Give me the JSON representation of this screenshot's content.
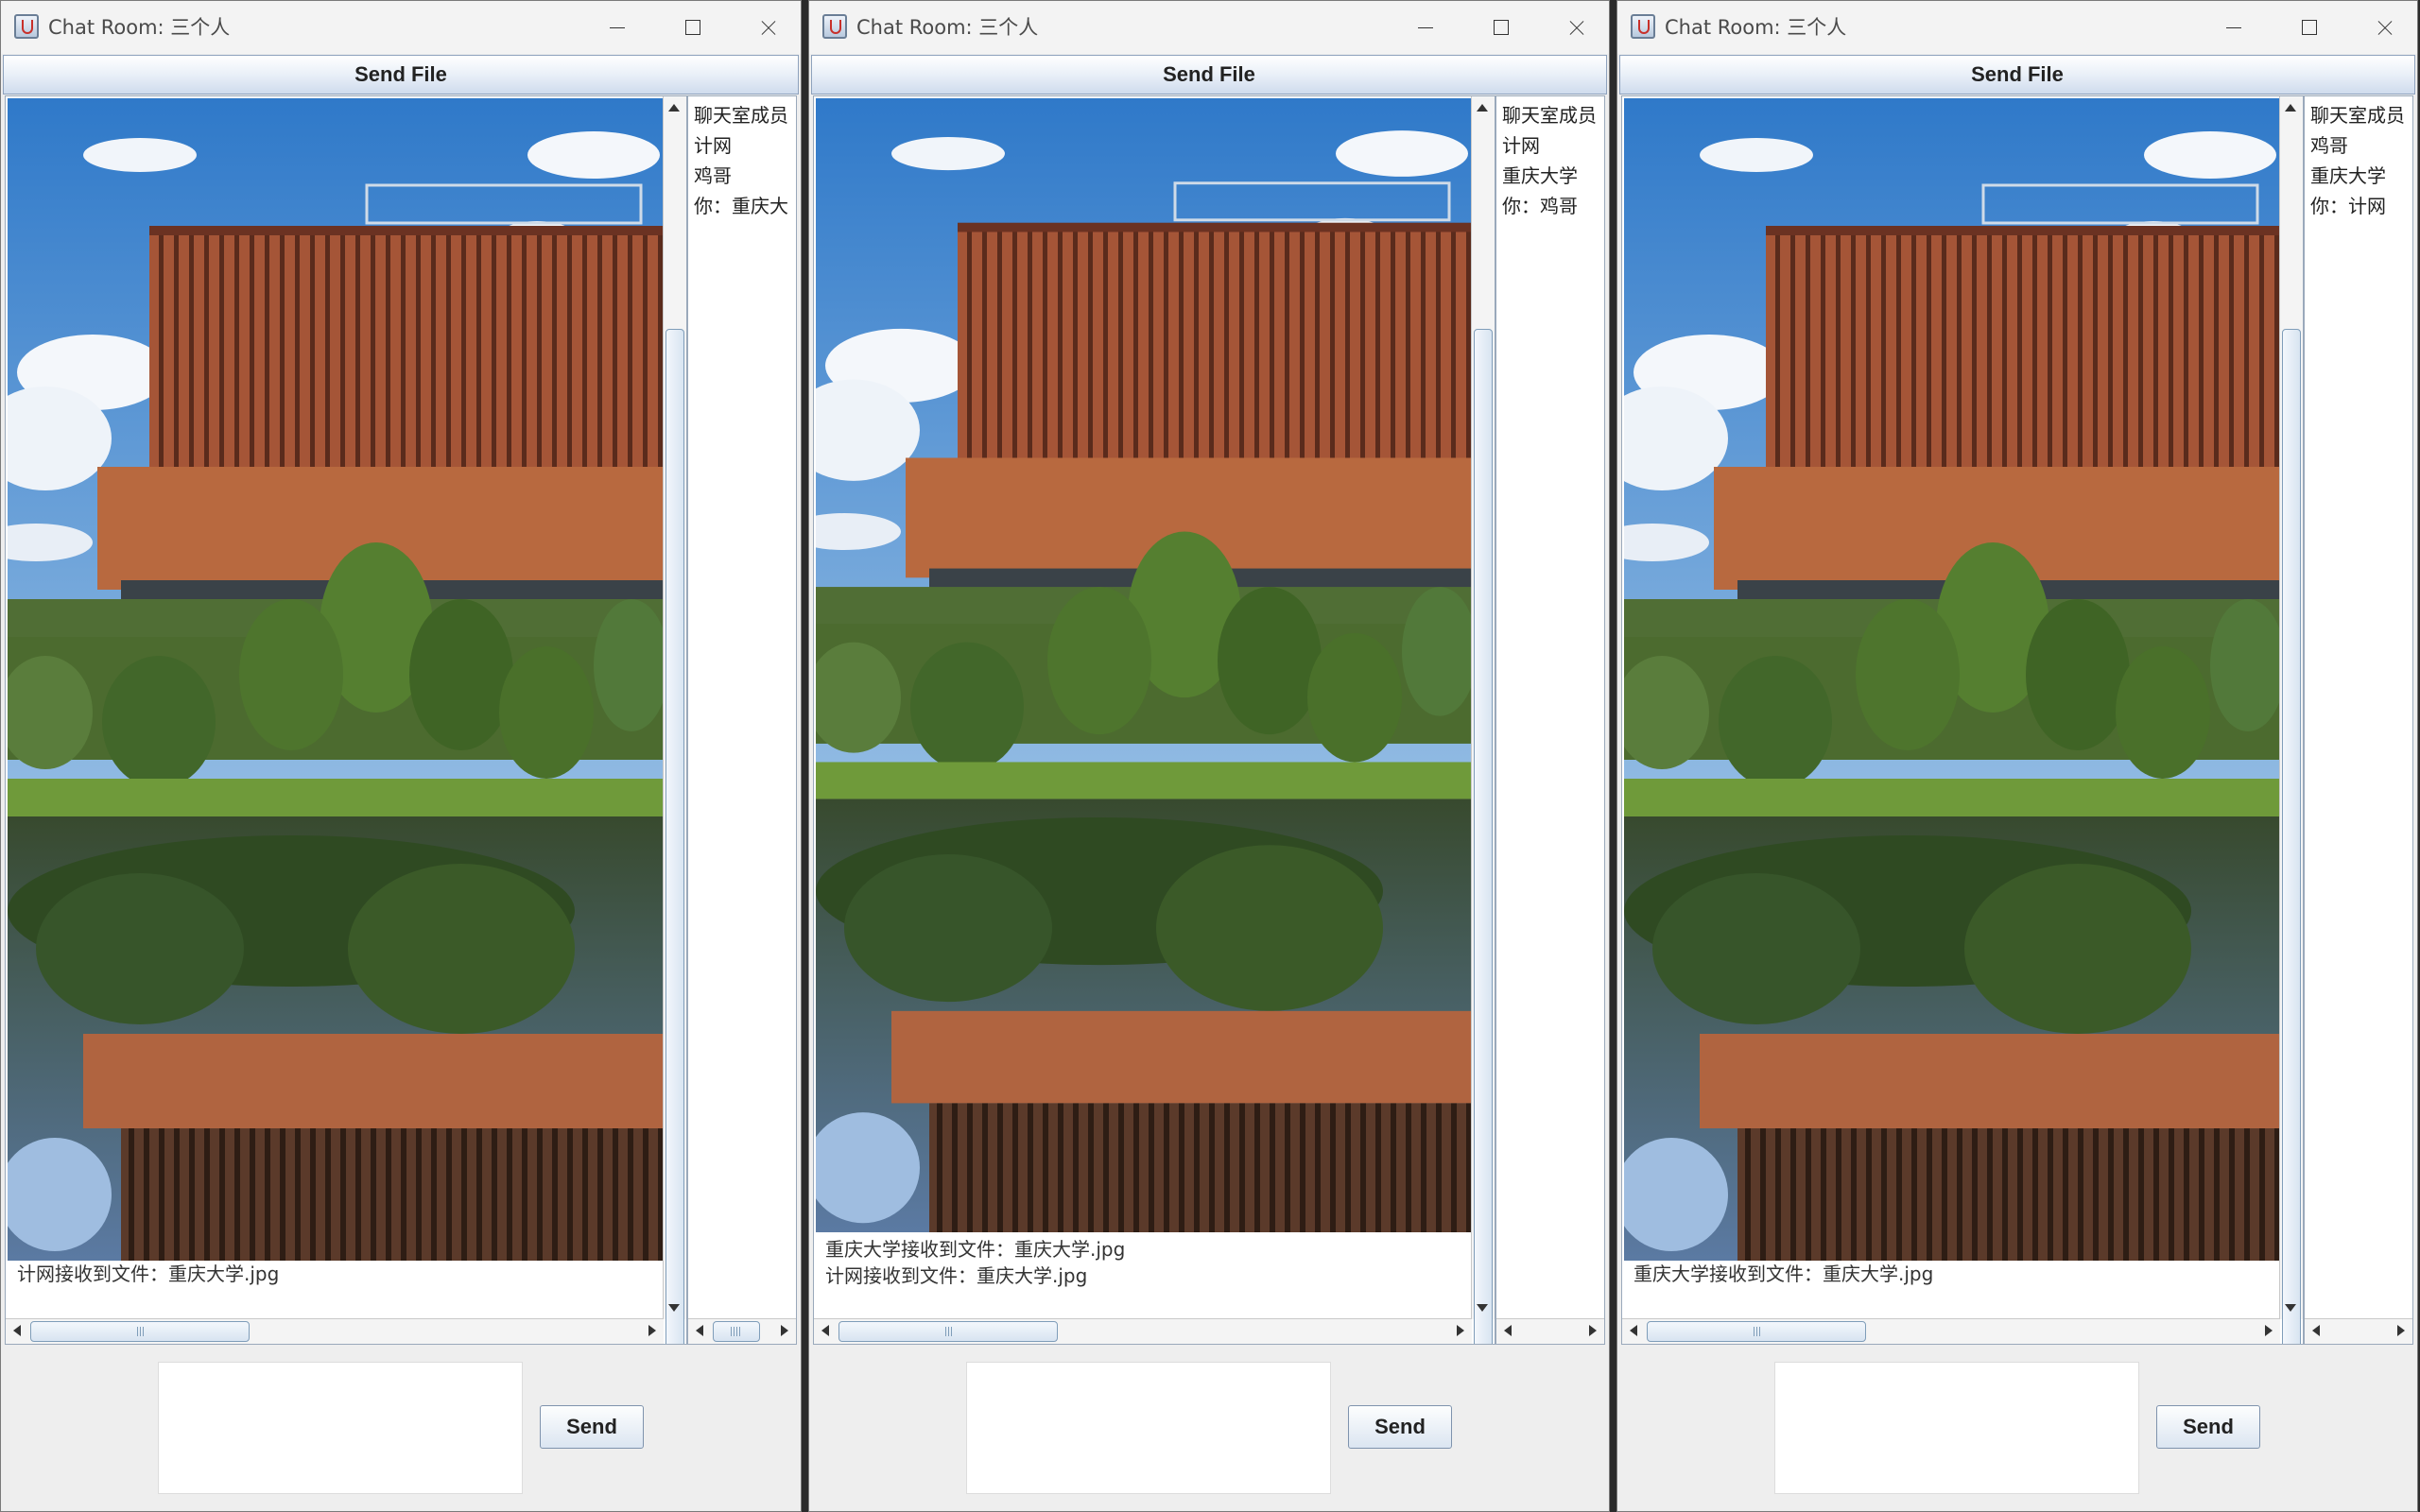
{
  "windows": [
    {
      "title": "Chat Room: 三个人",
      "send_file_label": "Send File",
      "chat_messages": [
        "计网接收到文件：重庆大学.jpg"
      ],
      "members": [
        "聊天室成员",
        "计网",
        "鸡哥",
        "你：重庆大"
      ],
      "send_label": "Send"
    },
    {
      "title": "Chat Room: 三个人",
      "send_file_label": "Send File",
      "chat_messages": [
        "重庆大学接收到文件：重庆大学.jpg",
        "计网接收到文件：重庆大学.jpg"
      ],
      "members": [
        "聊天室成员",
        "计网",
        "重庆大学",
        "你：鸡哥"
      ],
      "send_label": "Send"
    },
    {
      "title": "Chat Room: 三个人",
      "send_file_label": "Send File",
      "chat_messages": [
        "重庆大学接收到文件：重庆大学.jpg"
      ],
      "members": [
        "聊天室成员",
        "鸡哥",
        "重庆大学",
        "你：计网"
      ],
      "send_label": "Send"
    }
  ],
  "icons": {
    "app": "java-cup-icon",
    "minimize": "minimize-icon",
    "maximize": "maximize-icon",
    "close": "close-icon"
  },
  "colors": {
    "button_gradient_top": "#ffffff",
    "button_gradient_bottom": "#cfdced",
    "scroll_thumb": "#d8e4f1",
    "window_bg": "#eeeeee"
  }
}
